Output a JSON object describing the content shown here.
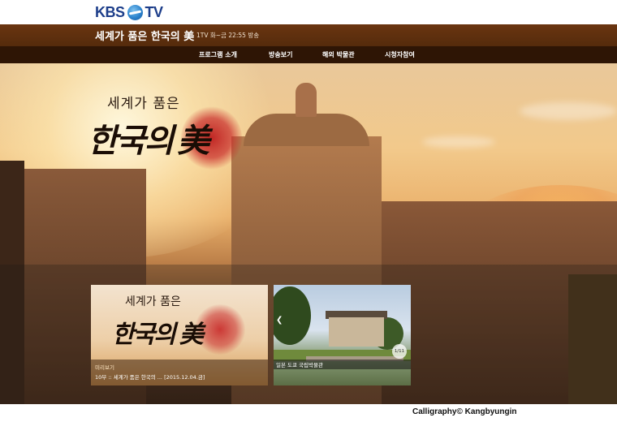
{
  "header": {
    "logo_left": "KBS",
    "logo_right": "TV"
  },
  "program": {
    "title": "세계가 품은 한국의 美",
    "schedule": "1TV 화~금 22:55 방송"
  },
  "nav": {
    "items": [
      {
        "label": "프로그램 소개"
      },
      {
        "label": "방송보기"
      },
      {
        "label": "해외 박물관"
      },
      {
        "label": "시청자참여"
      }
    ]
  },
  "hero": {
    "title_line1": "세계가 품은",
    "title_line2": "한국의",
    "title_char": "美"
  },
  "thumbnails": [
    {
      "title_line1": "세계가 품은",
      "title_line2": "한국의",
      "title_char": "美",
      "tag": "미리보기",
      "caption": "10부 :: 세계가 품은 한국의 ... [2015.12.04.금]"
    },
    {
      "counter": "1/11",
      "caption": "일본 도쿄 국립박물관"
    }
  ],
  "footer": {
    "credit": "Calligraphy© Kangbyungin"
  }
}
